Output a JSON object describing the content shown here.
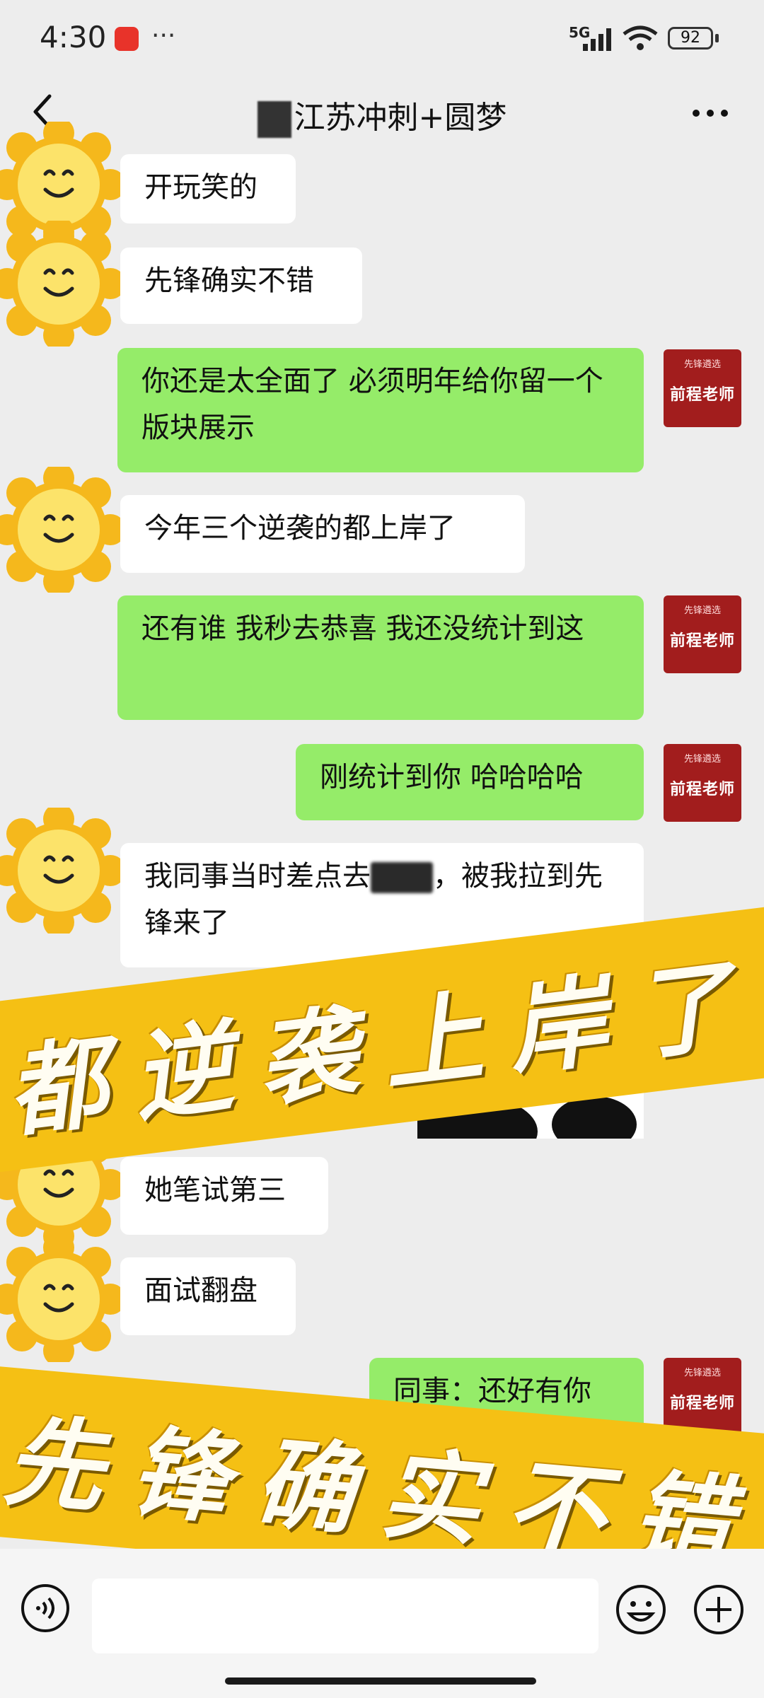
{
  "status_bar": {
    "time": "4:30",
    "dots": "···",
    "network": "5G",
    "battery": "92"
  },
  "header": {
    "title": "江苏冲刺+圆梦"
  },
  "teacher_avatar": {
    "label": "前程老师",
    "logo": "先锋遴选"
  },
  "messages": [
    {
      "side": "in",
      "text": "开玩笑的"
    },
    {
      "side": "in",
      "text": "先锋确实不错"
    },
    {
      "side": "out",
      "text": "你还是太全面了 必须明年给你留一个版块展示"
    },
    {
      "side": "in",
      "text": "今年三个逆袭的都上岸了"
    },
    {
      "side": "out",
      "text": "还有谁 我秒去恭喜 我还没统计到这"
    },
    {
      "side": "out",
      "text": "刚统计到你 哈哈哈哈"
    },
    {
      "side": "in",
      "text_before": "我同事当时差点去",
      "text_after": "，被我拉到先锋来了"
    },
    {
      "side": "in",
      "type": "sticker"
    },
    {
      "side": "in",
      "text": "她笔试第三"
    },
    {
      "side": "in",
      "text": "面试翻盘"
    },
    {
      "side": "out",
      "text": "同事：还好有你"
    }
  ],
  "banners": {
    "top": "都逆袭上岸了",
    "bottom": "先锋确实不错"
  },
  "colors": {
    "outgoing_bubble": "#95ec69",
    "incoming_bubble": "#ffffff",
    "banner": "#f5c014",
    "teacher_avatar": "#a21d1d"
  }
}
